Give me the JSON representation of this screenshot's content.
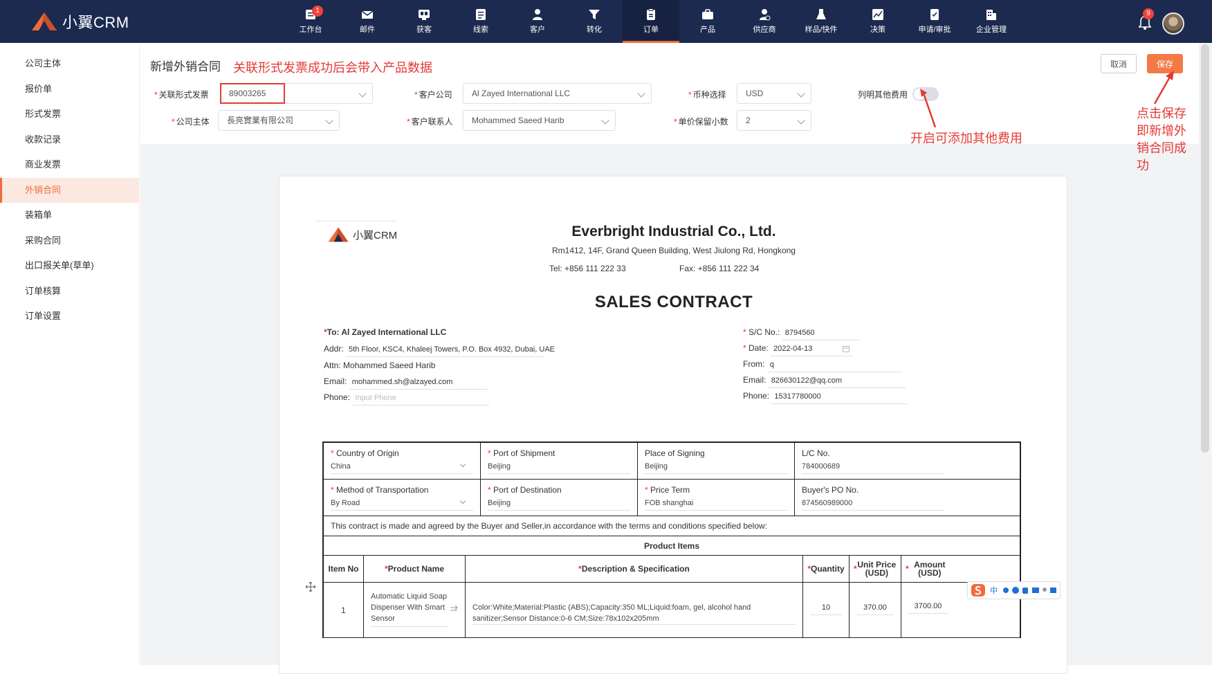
{
  "app": {
    "logo_text": "小翼CRM"
  },
  "nav": [
    {
      "label": "工作台",
      "icon": "dashboard-icon",
      "badge": "1"
    },
    {
      "label": "邮件",
      "icon": "mail-icon"
    },
    {
      "label": "获客",
      "icon": "acquire-icon"
    },
    {
      "label": "线索",
      "icon": "leads-icon"
    },
    {
      "label": "客户",
      "icon": "customer-icon"
    },
    {
      "label": "转化",
      "icon": "filter-icon"
    },
    {
      "label": "订单",
      "icon": "order-icon",
      "active": true
    },
    {
      "label": "产品",
      "icon": "product-icon"
    },
    {
      "label": "供应商",
      "icon": "supplier-icon"
    },
    {
      "label": "样品/快件",
      "icon": "sample-icon"
    },
    {
      "label": "决策",
      "icon": "chart-icon"
    },
    {
      "label": "申请/审批",
      "icon": "approval-icon"
    },
    {
      "label": "企业管理",
      "icon": "building-icon"
    }
  ],
  "notifications": {
    "badge": "9"
  },
  "sidebar": {
    "items": [
      {
        "label": "公司主体"
      },
      {
        "label": "报价单"
      },
      {
        "label": "形式发票"
      },
      {
        "label": "收款记录"
      },
      {
        "label": "商业发票"
      },
      {
        "label": "外销合同",
        "active": true
      },
      {
        "label": "装箱单"
      },
      {
        "label": "采购合同"
      },
      {
        "label": "出口报关单(草单)"
      },
      {
        "label": "订单核算"
      },
      {
        "label": "订单设置"
      }
    ]
  },
  "header": {
    "title": "新增外销合同",
    "hint_proforma": "关联形式发票成功后会带入产品数据",
    "hint_other_fees": "开启可添加其他费用",
    "hint_save": "点击保存即新增外销合同成功",
    "cancel_label": "取消",
    "save_label": "保存"
  },
  "form": {
    "proforma_label": "关联形式发票",
    "proforma_value": "89003265",
    "customer_company_label": "客户公司",
    "customer_company_value": "Al Zayed International LLC",
    "currency_label": "币种选择",
    "currency_value": "USD",
    "other_fees_label": "列明其他费用",
    "company_label": "公司主体",
    "company_value": "長亮實業有限公司",
    "contact_label": "客户联系人",
    "contact_value": "Mohammed Saeed Harib",
    "decimals_label": "单价保留小数",
    "decimals_value": "2"
  },
  "doc": {
    "logo_text": "小翼CRM",
    "company_name": "Everbright Industrial Co., Ltd.",
    "company_address": "Rm1412, 14F, Grand Queen Building, West Jiulong Rd, Hongkong",
    "tel": "Tel: +856 111 222 33",
    "fax": "Fax: +856 111 222 34",
    "title": "SALES CONTRACT",
    "to_label": "To:",
    "to_value": "Al Zayed International LLC",
    "addr_label": "Addr:",
    "addr_value": "5th Floor, KSC4, Khaleej Towers, P.O. Box 4932, Dubai, UAE",
    "attn_label": "Attn:",
    "attn_value": "Mohammed Saeed Harib",
    "email_label": "Email:",
    "email_value": "mohammed.sh@alzayed.com",
    "phone_label": "Phone:",
    "phone_placeholder": "Input Phone",
    "sc_label": "S/C No.:",
    "sc_value": "8794560",
    "date_label": "Date:",
    "date_value": "2022-04-13",
    "from_label": "From:",
    "from_value": "q",
    "seller_email_label": "Email:",
    "seller_email_value": "826630122@qq.com",
    "seller_phone_label": "Phone:",
    "seller_phone_value": "15317780000",
    "terms": {
      "country_label": "Country of Origin",
      "country_value": "China",
      "shipment_label": "Port of Shipment",
      "shipment_value": "Beijing",
      "signing_label": "Place of Signing",
      "signing_value": "Beijing",
      "lc_label": "L/C No.",
      "lc_value": "784000689",
      "transport_label": "Method of Transportation",
      "transport_value": "By Road",
      "destination_label": "Port of Destination",
      "destination_value": "Beijing",
      "price_term_label": "Price Term",
      "price_term_value": "FOB shanghai",
      "po_label": "Buyer's PO No.",
      "po_value": "874560989000"
    },
    "agreement": "This contract is made and agreed by the Buyer and Seller,in accordance with the terms and conditions specified below:",
    "product_items_title": "Product Items",
    "columns": {
      "item_no": "Item No",
      "product_name": "Product Name",
      "description": "Description & Specification",
      "quantity": "Quantity",
      "unit_price": "Unit Price (USD)",
      "amount": "Amount (USD)"
    },
    "rows": [
      {
        "item_no": "1",
        "product_name": "Automatic Liquid Soap Dispenser With Smart Sensor",
        "description": "Color:White;Material:Plastic (ABS);Capacity:350 ML;Liquid:foam, gel, alcohol hand sanitizer;Sensor Distance:0-6 CM;Size:78x102x205mm",
        "quantity": "10",
        "unit_price": "370.00",
        "amount": "3700.00"
      }
    ]
  },
  "ime": {
    "label": "中"
  },
  "colors": {
    "nav_bg": "#1b2a4e",
    "accent": "#f26b3a",
    "annotation_red": "#e53935"
  }
}
